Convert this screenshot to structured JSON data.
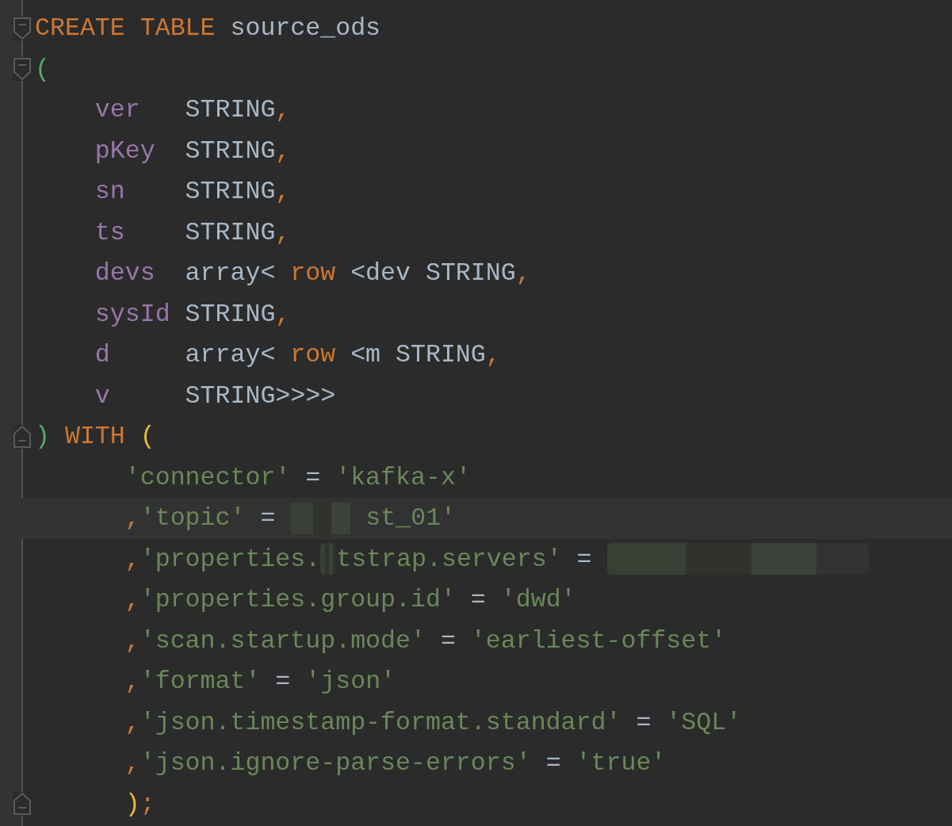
{
  "editor": {
    "lines": [
      {
        "fold": {
          "kind": "start"
        },
        "current": false,
        "tokens": [
          {
            "kind": "kw",
            "text": "CREATE TABLE "
          },
          {
            "kind": "id",
            "text": "source_ods"
          }
        ]
      },
      {
        "fold": {
          "kind": "start"
        },
        "current": false,
        "tokens": [
          {
            "kind": "paren-green",
            "text": "("
          }
        ]
      },
      {
        "current": false,
        "tokens": [
          {
            "kind": "col",
            "text": "    ver   "
          },
          {
            "kind": "id",
            "text": "STRING"
          },
          {
            "kind": "punc",
            "text": ","
          }
        ]
      },
      {
        "current": false,
        "tokens": [
          {
            "kind": "col",
            "text": "    pKey  "
          },
          {
            "kind": "id",
            "text": "STRING"
          },
          {
            "kind": "punc",
            "text": ","
          }
        ]
      },
      {
        "current": false,
        "tokens": [
          {
            "kind": "col",
            "text": "    sn    "
          },
          {
            "kind": "id",
            "text": "STRING"
          },
          {
            "kind": "punc",
            "text": ","
          }
        ]
      },
      {
        "current": false,
        "tokens": [
          {
            "kind": "col",
            "text": "    ts    "
          },
          {
            "kind": "id",
            "text": "STRING"
          },
          {
            "kind": "punc",
            "text": ","
          }
        ]
      },
      {
        "current": false,
        "tokens": [
          {
            "kind": "col",
            "text": "    devs  "
          },
          {
            "kind": "id",
            "text": "array< "
          },
          {
            "kind": "kw",
            "text": "row "
          },
          {
            "kind": "id",
            "text": "<dev STRING"
          },
          {
            "kind": "punc",
            "text": ","
          }
        ]
      },
      {
        "current": false,
        "tokens": [
          {
            "kind": "col",
            "text": "    sysId "
          },
          {
            "kind": "id",
            "text": "STRING"
          },
          {
            "kind": "punc",
            "text": ","
          }
        ]
      },
      {
        "current": false,
        "tokens": [
          {
            "kind": "col",
            "text": "    d     "
          },
          {
            "kind": "id",
            "text": "array< "
          },
          {
            "kind": "kw",
            "text": "row "
          },
          {
            "kind": "id",
            "text": "<m STRING"
          },
          {
            "kind": "punc",
            "text": ","
          }
        ]
      },
      {
        "current": false,
        "tokens": [
          {
            "kind": "col",
            "text": "    v     "
          },
          {
            "kind": "id",
            "text": "STRING>>>>"
          }
        ]
      },
      {
        "fold": {
          "kind": "end"
        },
        "current": false,
        "tokens": [
          {
            "kind": "paren-green",
            "text": ")"
          },
          {
            "kind": "kw",
            "text": " WITH "
          },
          {
            "kind": "paren-yellow",
            "text": "("
          }
        ]
      },
      {
        "current": false,
        "tokens": [
          {
            "kind": "str",
            "text": "      'connector'"
          },
          {
            "kind": "op",
            "text": " = "
          },
          {
            "kind": "str",
            "text": "'kafka-x'"
          }
        ]
      },
      {
        "current": true,
        "tokens": [
          {
            "kind": "punc",
            "text": "      ,"
          },
          {
            "kind": "str",
            "text": "'topic'"
          },
          {
            "kind": "op",
            "text": " = "
          },
          {
            "kind": "redacted-short"
          },
          {
            "kind": "str",
            "text": "st_01'"
          }
        ]
      },
      {
        "current": false,
        "tokens": [
          {
            "kind": "punc",
            "text": "      ,"
          },
          {
            "kind": "str",
            "text": "'properties."
          },
          {
            "kind": "redacted-tiny"
          },
          {
            "kind": "str",
            "text": "tstrap.servers'"
          },
          {
            "kind": "op",
            "text": " = "
          },
          {
            "kind": "redacted-long"
          }
        ]
      },
      {
        "current": false,
        "tokens": [
          {
            "kind": "punc",
            "text": "      ,"
          },
          {
            "kind": "str",
            "text": "'properties.group.id'"
          },
          {
            "kind": "op",
            "text": " = "
          },
          {
            "kind": "str",
            "text": "'dwd'"
          }
        ]
      },
      {
        "current": false,
        "tokens": [
          {
            "kind": "punc",
            "text": "      ,"
          },
          {
            "kind": "str",
            "text": "'scan.startup.mode'"
          },
          {
            "kind": "op",
            "text": " = "
          },
          {
            "kind": "str",
            "text": "'earliest-offset'"
          }
        ]
      },
      {
        "current": false,
        "tokens": [
          {
            "kind": "punc",
            "text": "      ,"
          },
          {
            "kind": "str",
            "text": "'format'"
          },
          {
            "kind": "op",
            "text": " = "
          },
          {
            "kind": "str",
            "text": "'json'"
          }
        ]
      },
      {
        "current": false,
        "tokens": [
          {
            "kind": "punc",
            "text": "      ,"
          },
          {
            "kind": "str",
            "text": "'json.timestamp-format.standard'"
          },
          {
            "kind": "op",
            "text": " = "
          },
          {
            "kind": "str",
            "text": "'SQL'"
          }
        ]
      },
      {
        "current": false,
        "tokens": [
          {
            "kind": "punc",
            "text": "      ,"
          },
          {
            "kind": "str",
            "text": "'json.ignore-parse-errors'"
          },
          {
            "kind": "op",
            "text": " = "
          },
          {
            "kind": "str",
            "text": "'true'"
          }
        ]
      },
      {
        "fold": {
          "kind": "end"
        },
        "current": false,
        "tokens": [
          {
            "kind": "paren-yellow",
            "text": "      )"
          },
          {
            "kind": "punc",
            "text": ";"
          }
        ]
      }
    ]
  }
}
